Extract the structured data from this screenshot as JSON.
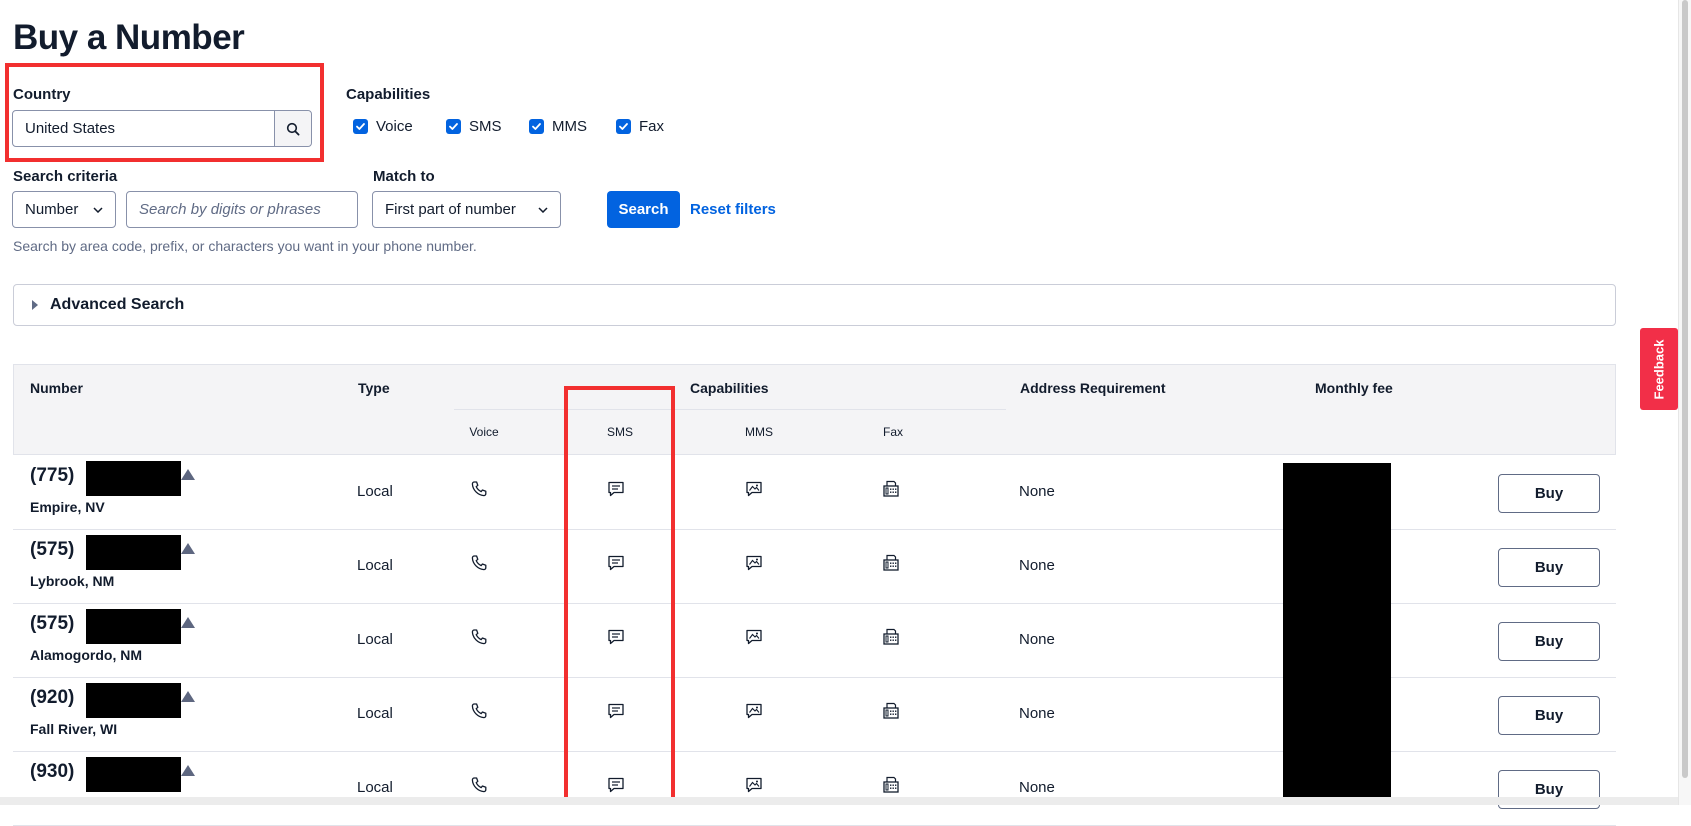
{
  "page": {
    "title": "Buy a Number"
  },
  "country": {
    "label": "Country",
    "value": "United States"
  },
  "capabilities": {
    "label": "Capabilities",
    "items": [
      {
        "label": "Voice",
        "checked": true
      },
      {
        "label": "SMS",
        "checked": true
      },
      {
        "label": "MMS",
        "checked": true
      },
      {
        "label": "Fax",
        "checked": true
      }
    ]
  },
  "search_criteria": {
    "label": "Search criteria",
    "selected": "Number",
    "placeholder": "Search by digits or phrases"
  },
  "match_to": {
    "label": "Match to",
    "selected": "First part of number"
  },
  "search_button": "Search",
  "reset_link": "Reset filters",
  "help_text": "Search by area code, prefix, or characters you want in your phone number.",
  "advanced_search": "Advanced Search",
  "table": {
    "headers": {
      "number": "Number",
      "type": "Type",
      "capabilities": "Capabilities",
      "address": "Address Requirement",
      "fee": "Monthly fee",
      "voice": "Voice",
      "sms": "SMS",
      "mms": "MMS",
      "fax": "Fax"
    },
    "rows": [
      {
        "area": "(775)",
        "city": "Empire, NV",
        "type": "Local",
        "address": "None",
        "buy": "Buy"
      },
      {
        "area": "(575)",
        "city": "Lybrook, NM",
        "type": "Local",
        "address": "None",
        "buy": "Buy"
      },
      {
        "area": "(575)",
        "city": "Alamogordo, NM",
        "type": "Local",
        "address": "None",
        "buy": "Buy"
      },
      {
        "area": "(920)",
        "city": "Fall River, WI",
        "type": "Local",
        "address": "None",
        "buy": "Buy"
      },
      {
        "area": "(930)",
        "city": "",
        "type": "Local",
        "address": "None",
        "buy": "Buy"
      }
    ]
  },
  "feedback": "Feedback",
  "colors": {
    "accent": "#0263e0",
    "highlight": "#f22f2f",
    "feedback": "#f22f48"
  },
  "icons": [
    "search-icon",
    "check-icon",
    "chevron-down-icon",
    "caret-right-icon",
    "phone-icon",
    "sms-icon",
    "mms-icon",
    "fax-icon",
    "sort-up-icon"
  ]
}
